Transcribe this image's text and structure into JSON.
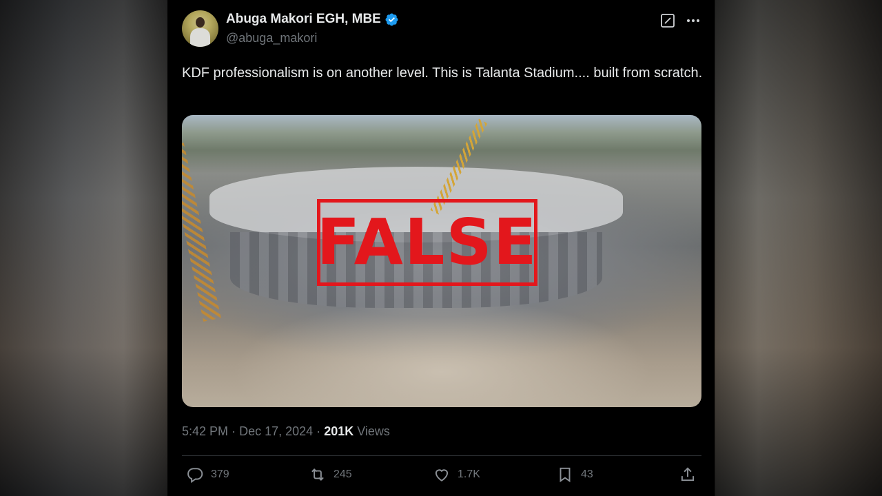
{
  "tweet": {
    "author": {
      "display_name": "Abuga Makori EGH, MBE",
      "handle": "@abuga_makori",
      "verified": true
    },
    "text": "KDF professionalism is on another level. This is Talanta Stadium.... built from scratch.",
    "media": {
      "stamp_text": "FALSE",
      "stamp_color": "#e3171c"
    },
    "meta": {
      "time": "5:42 PM",
      "separator": "·",
      "date": "Dec 17, 2024",
      "views_count": "201K",
      "views_label": "Views"
    },
    "actions": {
      "replies": "379",
      "reposts": "245",
      "likes": "1.7K",
      "bookmarks": "43"
    }
  },
  "colors": {
    "verified": "#1d9bf0",
    "secondary_text": "#71767b",
    "primary_text": "#e7e9ea"
  },
  "icons": [
    "verified-badge-icon",
    "grok-icon",
    "more-icon",
    "reply-icon",
    "repost-icon",
    "like-icon",
    "bookmark-icon",
    "share-icon"
  ]
}
